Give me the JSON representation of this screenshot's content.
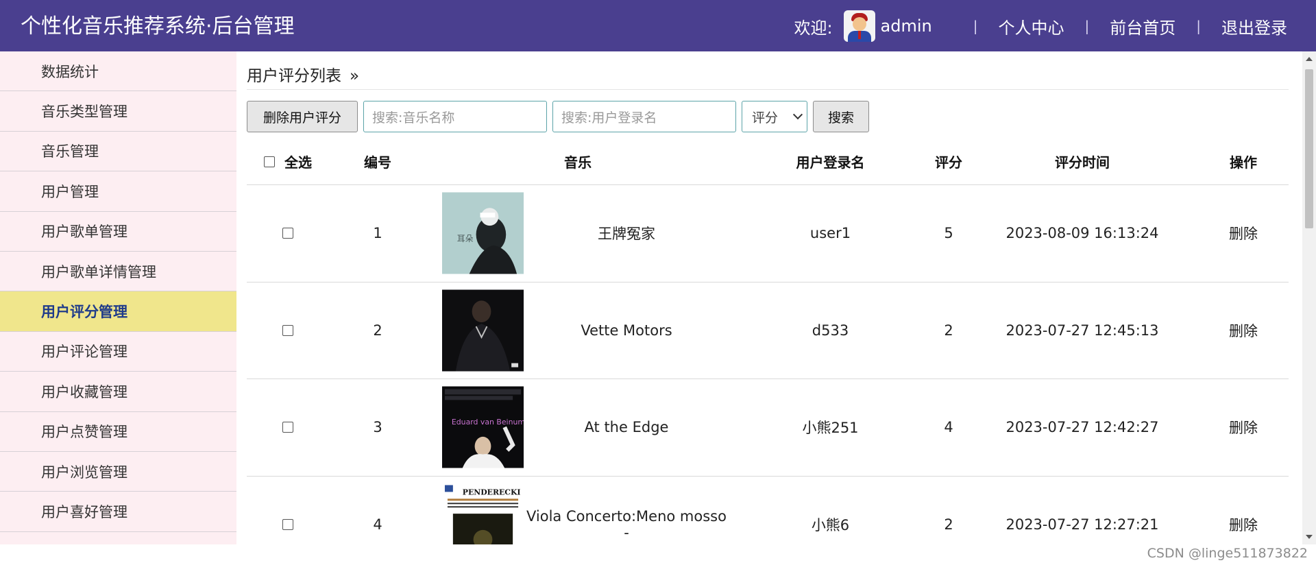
{
  "header": {
    "app_title": "个性化音乐推荐系统·后台管理",
    "welcome": "欢迎:",
    "username": "admin",
    "separator": "|",
    "links": [
      "个人中心",
      "前台首页",
      "退出登录"
    ]
  },
  "sidebar": {
    "items": [
      {
        "label": "数据统计"
      },
      {
        "label": "音乐类型管理"
      },
      {
        "label": "音乐管理"
      },
      {
        "label": "用户管理"
      },
      {
        "label": "用户歌单管理"
      },
      {
        "label": "用户歌单详情管理"
      },
      {
        "label": "用户评分管理",
        "active": true
      },
      {
        "label": "用户评论管理"
      },
      {
        "label": "用户收藏管理"
      },
      {
        "label": "用户点赞管理"
      },
      {
        "label": "用户浏览管理"
      },
      {
        "label": "用户喜好管理"
      }
    ]
  },
  "breadcrumb": {
    "title": "用户评分列表",
    "chevron": "»"
  },
  "toolbar": {
    "delete_label": "删除用户评分",
    "search_music_placeholder": "搜索:音乐名称",
    "search_user_placeholder": "搜索:用户登录名",
    "score_select_value": "评分",
    "search_label": "搜索"
  },
  "table": {
    "headers": {
      "select_all": "全选",
      "id": "编号",
      "music": "音乐",
      "user": "用户登录名",
      "score": "评分",
      "time": "评分时间",
      "action": "操作"
    },
    "rows": [
      {
        "id": "1",
        "music": "王牌冤家",
        "user": "user1",
        "score": "5",
        "time": "2023-08-09 16:13:24",
        "action": "删除",
        "cover_text": "耳朵"
      },
      {
        "id": "2",
        "music": "Vette Motors",
        "user": "d533",
        "score": "2",
        "time": "2023-07-27 12:45:13",
        "action": "删除",
        "cover_text": ""
      },
      {
        "id": "3",
        "music": "At the Edge",
        "user": "小熊251",
        "score": "4",
        "time": "2023-07-27 12:42:27",
        "action": "删除",
        "cover_text": "Eduard van Beinum"
      },
      {
        "id": "4",
        "music": "Viola Concerto:Meno mosso -",
        "user": "小熊6",
        "score": "2",
        "time": "2023-07-27 12:27:21",
        "action": "删除",
        "cover_text": "PENDERECKI"
      }
    ]
  },
  "colors": {
    "header_bg": "#4a3f8f",
    "sidebar_bg": "#fdeef2",
    "active_bg": "#f0e68c"
  },
  "watermark": "CSDN @linge511873822"
}
